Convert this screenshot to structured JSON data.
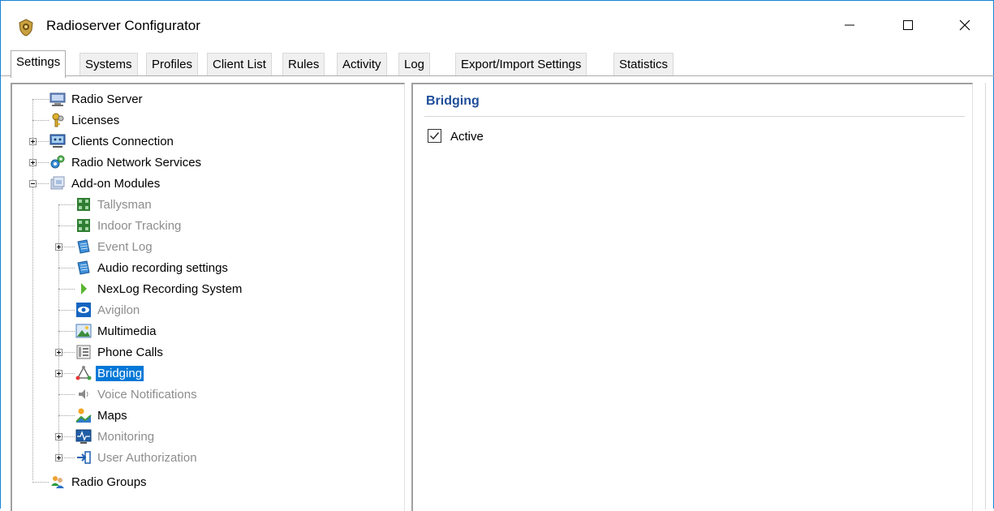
{
  "window": {
    "title": "Radioserver Configurator"
  },
  "tabs": [
    {
      "label": "Settings",
      "active": true
    },
    {
      "label": "Systems",
      "active": false
    },
    {
      "label": "Profiles",
      "active": false
    },
    {
      "label": "Client List",
      "active": false
    },
    {
      "label": "Rules",
      "active": false
    },
    {
      "label": "Activity",
      "active": false
    },
    {
      "label": "Log",
      "active": false
    },
    {
      "label": "Export/Import Settings",
      "active": false
    },
    {
      "label": "Statistics",
      "active": false
    }
  ],
  "tree": {
    "items": [
      {
        "label": "Radio Server",
        "icon": "server-icon",
        "disabled": false,
        "selected": false
      },
      {
        "label": "Licenses",
        "icon": "keys-icon",
        "disabled": false,
        "selected": false
      },
      {
        "label": "Clients Connection",
        "icon": "network-icon",
        "disabled": false,
        "selected": false,
        "expander": "plus"
      },
      {
        "label": "Radio Network Services",
        "icon": "gears-icon",
        "disabled": false,
        "selected": false,
        "expander": "plus"
      },
      {
        "label": "Add-on Modules",
        "icon": "modules-icon",
        "disabled": false,
        "selected": false,
        "expander": "minus"
      },
      {
        "label": "Tallysman",
        "icon": "tallysman-icon",
        "disabled": true,
        "selected": false
      },
      {
        "label": "Indoor Tracking",
        "icon": "indoor-tracking-icon",
        "disabled": true,
        "selected": false
      },
      {
        "label": "Event Log",
        "icon": "event-log-icon",
        "disabled": true,
        "selected": false,
        "expander": "plus"
      },
      {
        "label": "Audio recording settings",
        "icon": "audio-recording-icon",
        "disabled": false,
        "selected": false
      },
      {
        "label": "NexLog Recording System",
        "icon": "nexlog-arrow-icon",
        "disabled": false,
        "selected": false
      },
      {
        "label": "Avigilon",
        "icon": "eye-icon",
        "disabled": true,
        "selected": false
      },
      {
        "label": "Multimedia",
        "icon": "image-icon",
        "disabled": false,
        "selected": false
      },
      {
        "label": "Phone Calls",
        "icon": "phone-icon",
        "disabled": false,
        "selected": false,
        "expander": "plus"
      },
      {
        "label": "Bridging",
        "icon": "bridging-icon",
        "disabled": false,
        "selected": true,
        "expander": "plus"
      },
      {
        "label": "Voice Notifications",
        "icon": "speaker-icon",
        "disabled": true,
        "selected": false
      },
      {
        "label": "Maps",
        "icon": "map-icon",
        "disabled": false,
        "selected": false
      },
      {
        "label": "Monitoring",
        "icon": "monitoring-icon",
        "disabled": true,
        "selected": false,
        "expander": "plus"
      },
      {
        "label": "User Authorization",
        "icon": "login-arrow-icon",
        "disabled": true,
        "selected": false,
        "expander": "plus"
      },
      {
        "label": "Radio Groups",
        "icon": "users-icon",
        "disabled": false,
        "selected": false
      }
    ]
  },
  "detail": {
    "section_title": "Bridging",
    "active_label": "Active",
    "active_checked": true
  },
  "colors": {
    "accent": "#0078d7",
    "section_title": "#1f4e9a",
    "disabled_text": "#8d8d8d"
  }
}
